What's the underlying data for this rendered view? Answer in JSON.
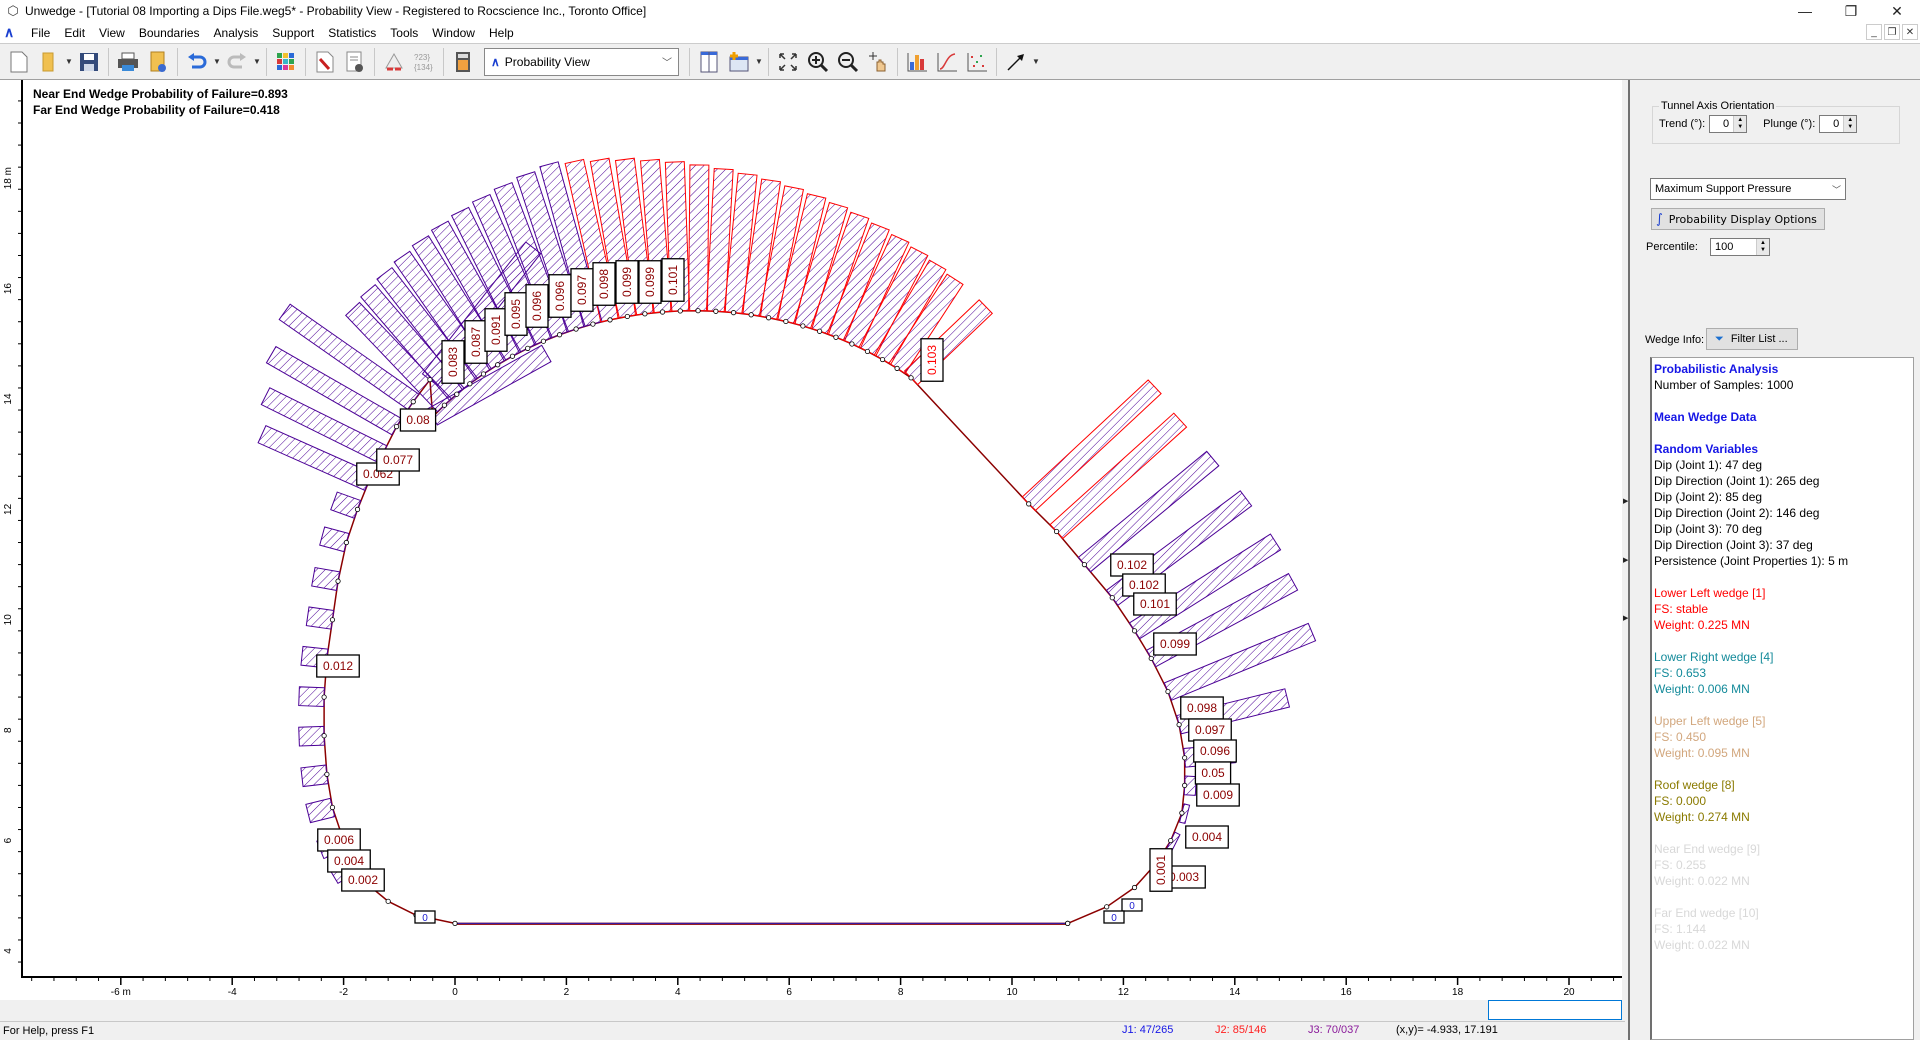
{
  "window": {
    "title": "Unwedge - [Tutorial 08 Importing a Dips File.weg5* - Probability View - Registered to Rocscience Inc., Toronto Office]",
    "controls": {
      "minimize": "—",
      "restore": "❐",
      "close": "✕"
    }
  },
  "menu": [
    "File",
    "Edit",
    "View",
    "Boundaries",
    "Analysis",
    "Support",
    "Statistics",
    "Tools",
    "Window",
    "Help"
  ],
  "toolbar": {
    "view_selector": "Probability View",
    "icons": [
      "new-file-icon",
      "open-folder-icon",
      "save-icon",
      "print-icon",
      "export-icon",
      "undo-icon",
      "redo-icon",
      "color-grid-icon",
      "edit-document-icon",
      "settings-document-icon",
      "wedge-tool-icon",
      "numbered-list-icon",
      "calculator-icon",
      "split-view-icon",
      "new-window-icon",
      "zoom-extents-icon",
      "zoom-in-icon",
      "zoom-out-icon",
      "pan-icon",
      "histogram-icon",
      "cumulative-icon",
      "scatter-icon",
      "arrow-icon"
    ]
  },
  "plot": {
    "pof_near": "Near End Wedge Probability of Failure=0.893",
    "pof_far": "Far End Wedge Probability of Failure=0.418",
    "x_axis_ticks": [
      "-6 m",
      "-4",
      "-2",
      "0",
      "2",
      "4",
      "6",
      "8",
      "10",
      "12",
      "14",
      "16",
      "18",
      "20"
    ],
    "y_axis_ticks": [
      "18 m",
      "16",
      "14",
      "12",
      "10",
      "8",
      "6",
      "4"
    ],
    "colors": {
      "red_bars": "#ff0000",
      "purple_bars": "#4b0096",
      "boundary": "#8b0000",
      "label_text": "#8b0000",
      "floor_blue": "#2020d0"
    },
    "labels": [
      {
        "text": "0.062"
      },
      {
        "text": "0.077"
      },
      {
        "text": "0.08"
      },
      {
        "text": "0.083"
      },
      {
        "text": "0.087"
      },
      {
        "text": "0.091"
      },
      {
        "text": "0.095"
      },
      {
        "text": "0.096"
      },
      {
        "text": "0.096"
      },
      {
        "text": "0.097"
      },
      {
        "text": "0.098"
      },
      {
        "text": "0.099"
      },
      {
        "text": "0.099"
      },
      {
        "text": "0.101"
      },
      {
        "text": "0.103"
      },
      {
        "text": "0.102"
      },
      {
        "text": "0.102"
      },
      {
        "text": "0.101"
      },
      {
        "text": "0.099"
      },
      {
        "text": "0.098"
      },
      {
        "text": "0.097"
      },
      {
        "text": "0.096"
      },
      {
        "text": "0.05"
      },
      {
        "text": "0.009"
      },
      {
        "text": "0.004"
      },
      {
        "text": "0.003"
      },
      {
        "text": "0.001"
      },
      {
        "text": "0"
      },
      {
        "text": "0"
      },
      {
        "text": "0.012"
      },
      {
        "text": "0.006"
      },
      {
        "text": "0.004"
      },
      {
        "text": "0.002"
      },
      {
        "text": "0"
      }
    ]
  },
  "status": {
    "help": "For Help, press F1",
    "j1": "J1: 47/265",
    "j2": "J2: 85/146",
    "j3": "J3: 70/037",
    "coords": "(x,y)= -4.933, 17.191"
  },
  "panel": {
    "tao_legend": "Tunnel Axis Orientation",
    "trend_label": "Trend (°):",
    "trend_value": "0",
    "plunge_label": "Plunge (°):",
    "plunge_value": "0",
    "metric": "Maximum Support Pressure",
    "pdo_button": "Probability Display Options",
    "percentile_label": "Percentile:",
    "percentile_value": "100",
    "wedge_info_label": "Wedge Info:",
    "filter_button": "Filter List ...",
    "info": {
      "prob_heading": "Probabilistic Analysis",
      "samples": "Number of Samples: 1000",
      "mean_heading": "Mean Wedge Data",
      "rv_heading": "Random Variables",
      "rv": [
        "Dip (Joint 1): 47 deg",
        "Dip Direction (Joint 1): 265 deg",
        "Dip (Joint 2): 85 deg",
        "Dip Direction (Joint 2): 146 deg",
        "Dip (Joint 3): 70 deg",
        "Dip Direction (Joint 3): 37 deg",
        "Persistence (Joint Properties 1): 5 m"
      ],
      "wedges": [
        {
          "name": "Lower Left wedge [1]",
          "fs": "FS: stable",
          "weight": "Weight: 0.225 MN",
          "color": "#ff0000"
        },
        {
          "name": "Lower Right wedge [4]",
          "fs": "FS: 0.653",
          "weight": "Weight: 0.006 MN",
          "color": "#138a9a"
        },
        {
          "name": "Upper Left wedge [5]",
          "fs": "FS: 0.450",
          "weight": "Weight: 0.095 MN",
          "color": "#d2a77e"
        },
        {
          "name": "Roof wedge [8]",
          "fs": "FS: 0.000",
          "weight": "Weight: 0.274 MN",
          "color": "#8a7a00"
        },
        {
          "name": "Near End wedge [9]",
          "fs": "FS: 0.255",
          "weight": "Weight: 0.022 MN",
          "color": "#d8d8d8"
        },
        {
          "name": "Far End wedge [10]",
          "fs": "FS: 1.144",
          "weight": "Weight: 0.022 MN",
          "color": "#d8d8d8"
        }
      ]
    }
  }
}
